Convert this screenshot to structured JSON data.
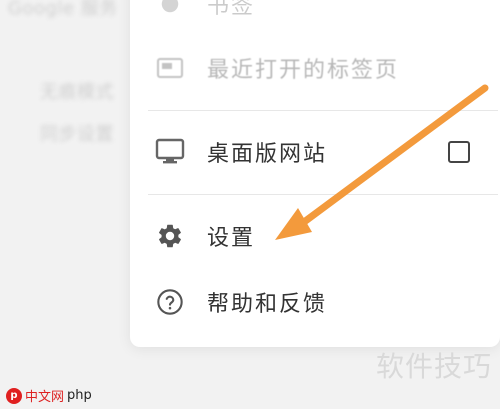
{
  "background": {
    "lines": [
      "Google 服务",
      "无痕模式",
      "同步设置"
    ]
  },
  "menu": {
    "top_item": {
      "label": "书签"
    },
    "items": [
      {
        "label": "最近打开的标签页",
        "icon": "recent-tabs-icon"
      },
      {
        "label": "桌面版网站",
        "icon": "monitor-icon",
        "checked": false
      },
      {
        "label": "设置",
        "icon": "gear-icon"
      },
      {
        "label": "帮助和反馈",
        "icon": "help-circle-icon"
      }
    ]
  },
  "annotation": {
    "arrow_color": "#f39a3c"
  },
  "watermark": {
    "right_text": "软件技巧",
    "logo_badge": "p",
    "logo_text": "中文网",
    "logo_site": "php"
  }
}
